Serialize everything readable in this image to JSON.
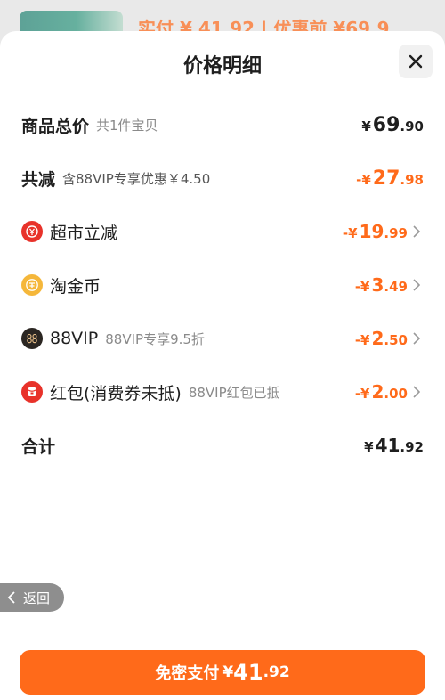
{
  "background": {
    "top_summary": "实付 ¥ 41.92 | 优惠前 ¥69.9"
  },
  "sheet": {
    "title": "价格明细",
    "close_icon": "close-icon"
  },
  "rows": [
    {
      "label": "商品总价",
      "sub": "共1件宝贝",
      "symbol": "¥",
      "int": "69",
      "dec": ".90"
    },
    {
      "label": "共减",
      "sub": "含88VIP专享优惠￥4.50",
      "symbol": "-¥",
      "int": "27",
      "dec": ".98"
    },
    {
      "label": "超市立减",
      "sub": "",
      "symbol": "-¥",
      "int": "19",
      "dec": ".99",
      "icon": "supermarket-discount-icon",
      "icon_color": "#e8322a"
    },
    {
      "label": "淘金币",
      "sub": "",
      "symbol": "-¥",
      "int": "3",
      "dec": ".49",
      "icon": "taojinbi-coin-icon",
      "icon_color": "#f5b73a"
    },
    {
      "label": "88VIP",
      "sub": "88VIP专享9.5折",
      "symbol": "-¥",
      "int": "2",
      "dec": ".50",
      "icon": "88vip-icon",
      "icon_color": "#2b2622"
    },
    {
      "label": "红包(消费券未抵)",
      "sub": "88VIP红包已抵",
      "symbol": "-¥",
      "int": "2",
      "dec": ".00",
      "icon": "red-packet-icon",
      "icon_color": "#e8322a"
    },
    {
      "label": "合计",
      "sub": "",
      "symbol": "¥",
      "int": "41",
      "dec": ".92"
    }
  ],
  "back": {
    "label": "返回"
  },
  "pay": {
    "label": "免密支付",
    "symbol": "¥",
    "int": "41",
    "dec": ".92"
  },
  "colors": {
    "accent": "#ff6a1a",
    "text": "#1f1f1f",
    "muted": "#8a8a8a"
  }
}
